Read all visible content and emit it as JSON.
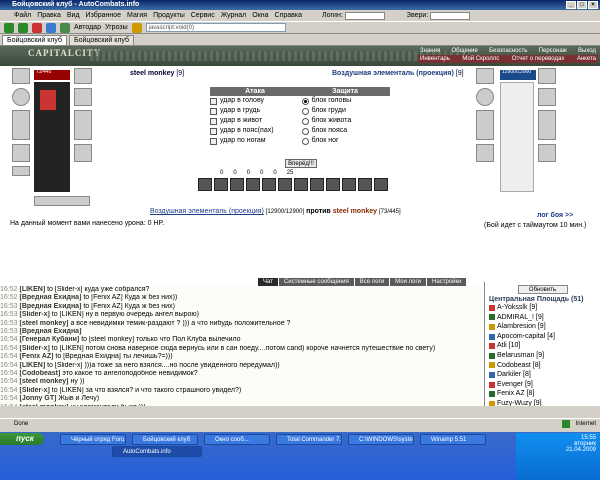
{
  "window": {
    "title": "Бойцовский клуб - AutoCombats.info",
    "controls": [
      "_",
      "□",
      "×"
    ]
  },
  "menu": [
    "Файл",
    "Правка",
    "Вид",
    "Избранное",
    "Магия",
    "Продукты",
    "Сервис",
    "Журнал",
    "Окна",
    "Справка"
  ],
  "menu_search": {
    "login_label": "Логин:",
    "zveri_label": "Звери:"
  },
  "toolbar": {
    "autodar": "Автодар",
    "ugroz": "Угрозы",
    "address": "javascript:void(0)"
  },
  "browser_tabs": [
    "Бойцовский клуб",
    "Бойцовский клуб"
  ],
  "game": {
    "logo": "CAPITALCITY",
    "nav_row1": [
      "Знания",
      "Общение",
      "Безопасность",
      "Персонаж",
      "Выход"
    ],
    "nav_row2": [
      "Инвентарь",
      "Мой Скроллс",
      "Отчет о переводах",
      "Анкета"
    ],
    "left_player": {
      "name": "steel monkey",
      "level": "[9]",
      "hp": "73/445"
    },
    "right_player": {
      "name": "Воздушная элементаль (проекция)",
      "level": "[9]",
      "hp": "12900/12900"
    },
    "attack_header": "Атака",
    "defense_header": "Защита",
    "attacks": [
      "удар в голову",
      "удар в грудь",
      "удар в живот",
      "удар в пояс(пах)",
      "удар по ногам"
    ],
    "defenses": [
      "блок головы",
      "блок груди",
      "блок живота",
      "блок пояса",
      "блок ног"
    ],
    "defense_selected": 0,
    "go_button": "Вперёд!!!",
    "counters": [
      "0",
      "0",
      "0",
      "0",
      "0",
      "25"
    ],
    "fight_left": "Воздушная элементаль (проекция)",
    "fight_left_hp": "[12900/12900]",
    "fight_vs": "против",
    "fight_right": "steel monkey",
    "fight_right_hp": "[73/445]",
    "damage_line": "На данный момент вами нанесено урона: 0 HP.",
    "log_link": "лог боя >>",
    "timeout": "(Бой идет с таймаутом 10 мин.)"
  },
  "chat_tabs": [
    "Чат",
    "Системные сообщения",
    "Все логи",
    "Мои логи",
    "Настройки"
  ],
  "chat": [
    {
      "t": "16:52",
      "n": "[LIKEN]",
      "m": " to [Slider-x] куда уже собрался?"
    },
    {
      "t": "16:52",
      "n": "[Вредная Ехидна]",
      "m": " to [Fenix AZ] Куда ж без них))"
    },
    {
      "t": "16:53",
      "n": "[Вредная Ехидна]",
      "m": " to [Fenix AZ] Куда ж без них)"
    },
    {
      "t": "16:53",
      "n": "[Slider-x]",
      "m": " to [LIKEN] ну в первую очередь ангел вырою)"
    },
    {
      "t": "16:53",
      "n": "[steel monkey]",
      "m": " а все невидимки темик-раздают ? ))) а что нибудь положительное ?"
    },
    {
      "t": "",
      "n": "",
      "m": ""
    },
    {
      "t": "16:53",
      "n": "[Вредная Ехидна]",
      "m": ""
    },
    {
      "t": "16:54",
      "n": "[Генерал Кубани]",
      "m": " to [steel monkey] только что Пол Клуба вылечило"
    },
    {
      "t": "16:54",
      "n": "[Slider-x]",
      "m": " to [LIKEN] потом снова наверное сюда вернусь или в сан поеду....потом сand) короче начнется путешествие по свету)"
    },
    {
      "t": "16:54",
      "n": "[Fenix AZ]",
      "m": " to [Вредная Ехидна] ты лечишь?=)))"
    },
    {
      "t": "16:54",
      "n": "[LIKEN]",
      "m": " to [Slider-x] )))а тоже за него взялся....но после увиденного передумал))"
    },
    {
      "t": "16:54",
      "n": "[Codobeast]",
      "m": " это какое то ангелоподобное невидимок?"
    },
    {
      "t": "16:54",
      "n": "[steel monkey]",
      "m": " ну ))"
    },
    {
      "t": "16:54",
      "n": "[Slider-x]",
      "m": " to [LIKEN] за что взялся? и что такого страшного увидел?)"
    },
    {
      "t": "16:54",
      "n": "[Jonny GT]",
      "m": " Жыв и Лечу)"
    },
    {
      "t": "16:54",
      "n": "[steel monkey]",
      "m": " ну элементали бьют )))"
    },
    {
      "t": "16:55",
      "n": "[mittus]",
      "m": " НЕВИДИМКА, верните пожалуйста бота на место!"
    },
    {
      "t": "16:55",
      "n": "[Codobeast]",
      "m": " пищащищ"
    },
    {
      "t": "16:55",
      "n": "[steel monkey]",
      "m": " за что ж так в призрак то сразу на -300"
    }
  ],
  "userlist": {
    "refresh": "Обновить",
    "place": "Центральная Площадь (51)",
    "users": [
      "A-Yoksslk [9]",
      "ADMIRAL_! [9]",
      "Alambresion [9]",
      "Apocom-capital [4]",
      "Atli [10]",
      "Belarusman [9]",
      "Codobeast [8]",
      "Darkiler [8]",
      "Evenger [9]",
      "Fenix AZ [8]",
      "Fuzy-Wuzy [9]",
      "germina [8]"
    ]
  },
  "statusbar": {
    "status": "Done",
    "zone": "Internet"
  },
  "taskbar": {
    "start": "пуск",
    "tasks": [
      "Чёрный отряд Foru...",
      "Бойцовский клуб",
      "Окно сооб...",
      "Total Commander 7.0...",
      "C:\\WINDOWS\\syste...",
      "Winamp 5.51",
      "AutoCombats.info"
    ],
    "clock": "15:55",
    "day": "вторник",
    "date": "21.04.2009"
  }
}
